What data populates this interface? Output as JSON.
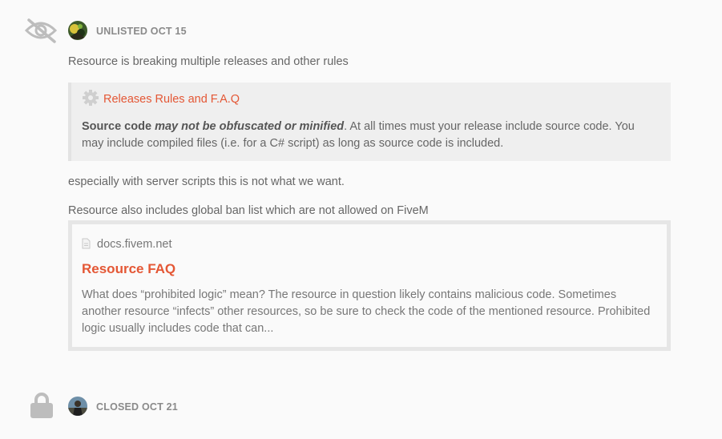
{
  "events": [
    {
      "type": "unlisted",
      "icon": "eye-slash-icon",
      "label": "UNLISTED OCT 15"
    },
    {
      "type": "closed",
      "icon": "lock-icon",
      "label": "CLOSED OCT 21"
    }
  ],
  "post": {
    "intro": "Resource is breaking multiple releases and other rules",
    "quote": {
      "title": "Releases Rules and F.A.Q",
      "bold": "Source code ",
      "bold_italic": "may not be obfuscated or minified",
      "rest": ". At all times must your release include source code. You may include compiled files (i.e. for a C# script) as long as source code is included."
    },
    "line2": "especially with server scripts this is not what we want.",
    "line3": "Resource also includes global ban list which are not allowed on FiveM",
    "onebox": {
      "source": "docs.fivem.net",
      "title": "Resource FAQ",
      "description": "What does “prohibited logic” mean? The resource in question likely contains malicious code. Sometimes another resource “infects” other resources, so be sure to check the code of the mentioned resource. Prohibited logic usually includes code that can..."
    }
  },
  "colors": {
    "accent": "#e45735",
    "meta": "#8a8a8a",
    "icon": "#bdbdbd"
  }
}
